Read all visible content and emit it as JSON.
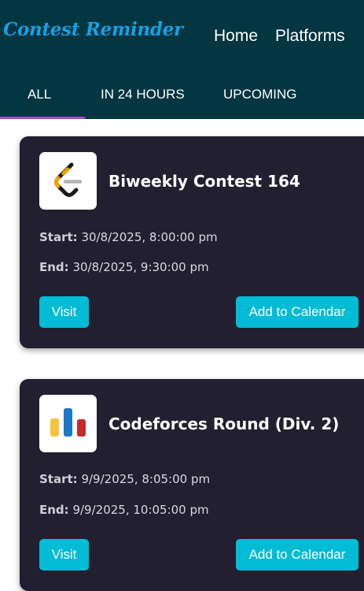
{
  "app": {
    "brand": "Contest Reminder"
  },
  "nav": {
    "home": "Home",
    "platforms": "Platforms"
  },
  "tabs": [
    {
      "label": "ALL",
      "active": true
    },
    {
      "label": "IN 24 HOURS",
      "active": false
    },
    {
      "label": "UPCOMING",
      "active": false
    }
  ],
  "contests": [
    {
      "title": "Biweekly Contest 164",
      "platform_icon": "leetcode-logo-icon",
      "start_label": "Start:",
      "start": "30/8/2025, 8:00:00 pm",
      "end_label": "End:",
      "end": "30/8/2025, 9:30:00 pm",
      "visit_label": "Visit",
      "calendar_label": "Add to Calendar"
    },
    {
      "title": "Codeforces Round (Div. 2)",
      "platform_icon": "codeforces-logo-icon",
      "start_label": "Start:",
      "start": "9/9/2025, 8:05:00 pm",
      "end_label": "End:",
      "end": "9/9/2025, 10:05:00 pm",
      "visit_label": "Visit",
      "calendar_label": "Add to Calendar"
    }
  ],
  "colors": {
    "header_bg": "#033640",
    "brand": "#16a0e6",
    "active_tab_underline": "#a347c6",
    "card_bg": "#211f30",
    "button_bg": "#02bcd6"
  }
}
